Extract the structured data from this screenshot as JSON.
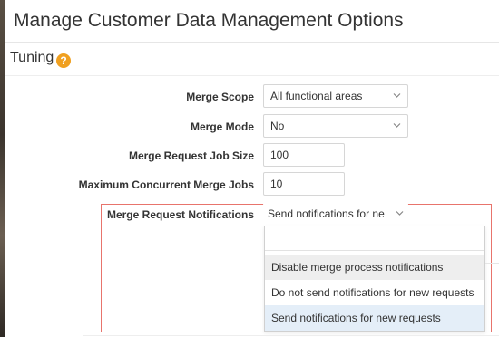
{
  "page": {
    "title": "Manage Customer Data Management Options"
  },
  "section": {
    "title": "Tuning",
    "help_icon": "question-mark-icon",
    "help_glyph": "?"
  },
  "form": {
    "merge_scope": {
      "label": "Merge Scope",
      "value": "All functional areas"
    },
    "merge_mode": {
      "label": "Merge Mode",
      "value": "No"
    },
    "job_size": {
      "label": "Merge Request Job Size",
      "value": "100"
    },
    "max_jobs": {
      "label": "Maximum Concurrent Merge Jobs",
      "value": "10"
    },
    "notifications": {
      "label": "Merge Request Notifications",
      "value": "Send notifications for ne"
    }
  },
  "dropdown": {
    "search_value": "",
    "options": [
      "Disable merge process notifications",
      "Do not send notifications for new requests",
      "Send notifications for new requests"
    ],
    "hovered_index": 0,
    "selected_index": 2
  },
  "colors": {
    "highlight_border": "#e8746c",
    "help_icon": "#f0a020",
    "selected_option": "#e4eef8"
  }
}
